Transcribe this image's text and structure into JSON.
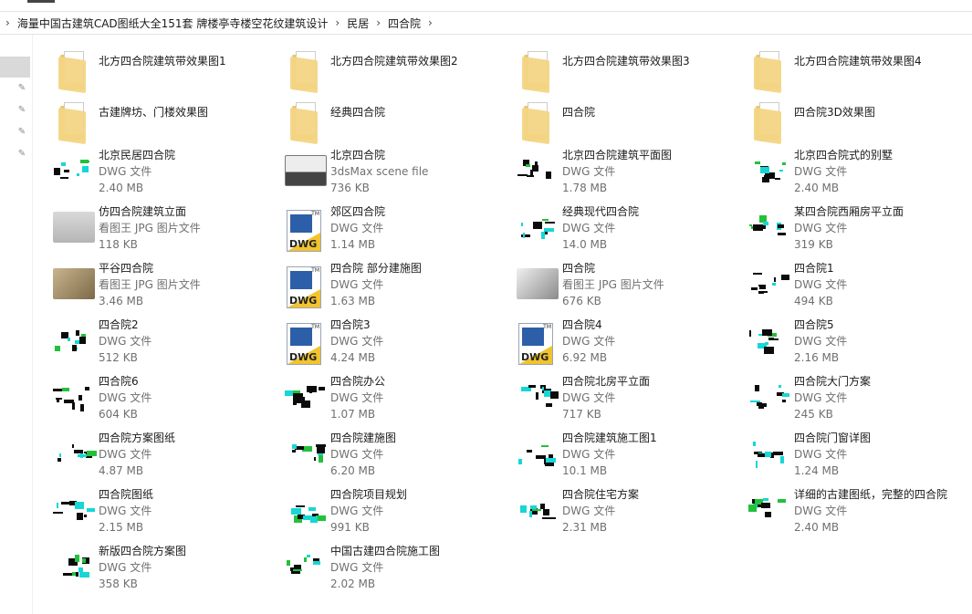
{
  "breadcrumb": [
    "海量中国古建筑CAD图纸大全151套 牌楼亭寺楼空花纹建筑设计",
    "民居",
    "四合院"
  ],
  "items": [
    {
      "name": "北方四合院建筑带效果图1",
      "kind": "folder"
    },
    {
      "name": "北方四合院建筑带效果图2",
      "kind": "folder"
    },
    {
      "name": "北方四合院建筑带效果图3",
      "kind": "folder"
    },
    {
      "name": "北方四合院建筑带效果图4",
      "kind": "folder"
    },
    {
      "name": "古建牌坊、门楼效果图",
      "kind": "folder"
    },
    {
      "name": "经典四合院",
      "kind": "folder"
    },
    {
      "name": "四合院",
      "kind": "folder"
    },
    {
      "name": "四合院3D效果图",
      "kind": "folder"
    },
    {
      "name": "北京民居四合院",
      "type": "DWG 文件",
      "size": "2.40 MB",
      "kind": "cad"
    },
    {
      "name": "北京四合院",
      "type": "3dsMax scene file",
      "size": "736 KB",
      "kind": "max"
    },
    {
      "name": "北京四合院建筑平面图",
      "type": "DWG 文件",
      "size": "1.78 MB",
      "kind": "cad"
    },
    {
      "name": "北京四合院式的别墅",
      "type": "DWG 文件",
      "size": "2.40 MB",
      "kind": "cad"
    },
    {
      "name": "仿四合院建筑立面",
      "type": "看图王 JPG 图片文件",
      "size": "118 KB",
      "kind": "photo"
    },
    {
      "name": "郊区四合院",
      "type": "DWG 文件",
      "size": "1.14 MB",
      "kind": "dwg"
    },
    {
      "name": "经典现代四合院",
      "type": "DWG 文件",
      "size": "14.0 MB",
      "kind": "cad"
    },
    {
      "name": "某四合院西厢房平立面",
      "type": "DWG 文件",
      "size": "319 KB",
      "kind": "cad"
    },
    {
      "name": "平谷四合院",
      "type": "看图王 JPG 图片文件",
      "size": "3.46 MB",
      "kind": "photo"
    },
    {
      "name": "四合院 部分建施图",
      "type": "DWG 文件",
      "size": "1.63 MB",
      "kind": "dwg"
    },
    {
      "name": "四合院",
      "type": "看图王 JPG 图片文件",
      "size": "676 KB",
      "kind": "photo"
    },
    {
      "name": "四合院1",
      "type": "DWG 文件",
      "size": "494 KB",
      "kind": "cad"
    },
    {
      "name": "四合院2",
      "type": "DWG 文件",
      "size": "512 KB",
      "kind": "cad"
    },
    {
      "name": "四合院3",
      "type": "DWG 文件",
      "size": "4.24 MB",
      "kind": "dwg"
    },
    {
      "name": "四合院4",
      "type": "DWG 文件",
      "size": "6.92 MB",
      "kind": "dwg"
    },
    {
      "name": "四合院5",
      "type": "DWG 文件",
      "size": "2.16 MB",
      "kind": "cad"
    },
    {
      "name": "四合院6",
      "type": "DWG 文件",
      "size": "604 KB",
      "kind": "cad"
    },
    {
      "name": "四合院办公",
      "type": "DWG 文件",
      "size": "1.07 MB",
      "kind": "cad"
    },
    {
      "name": "四合院北房平立面",
      "type": "DWG 文件",
      "size": "717 KB",
      "kind": "cad"
    },
    {
      "name": "四合院大门方案",
      "type": "DWG 文件",
      "size": "245 KB",
      "kind": "cad"
    },
    {
      "name": "四合院方案图纸",
      "type": "DWG 文件",
      "size": "4.87 MB",
      "kind": "cad"
    },
    {
      "name": "四合院建施图",
      "type": "DWG 文件",
      "size": "6.20 MB",
      "kind": "cad"
    },
    {
      "name": "四合院建筑施工图1",
      "type": "DWG 文件",
      "size": "10.1 MB",
      "kind": "cad"
    },
    {
      "name": "四合院门窗详图",
      "type": "DWG 文件",
      "size": "1.24 MB",
      "kind": "cad"
    },
    {
      "name": "四合院图纸",
      "type": "DWG 文件",
      "size": "2.15 MB",
      "kind": "cad"
    },
    {
      "name": "四合院项目规划",
      "type": "DWG 文件",
      "size": "991 KB",
      "kind": "cad"
    },
    {
      "name": "四合院住宅方案",
      "type": "DWG 文件",
      "size": "2.31 MB",
      "kind": "cad"
    },
    {
      "name": "详细的古建图纸，完整的四合院",
      "type": "DWG 文件",
      "size": "2.40 MB",
      "kind": "cad"
    },
    {
      "name": "新版四合院方案图",
      "type": "DWG 文件",
      "size": "358 KB",
      "kind": "cad"
    },
    {
      "name": "中国古建四合院施工图",
      "type": "DWG 文件",
      "size": "2.02 MB",
      "kind": "cad"
    }
  ],
  "dwg_label": "DWG",
  "tm": "TM"
}
